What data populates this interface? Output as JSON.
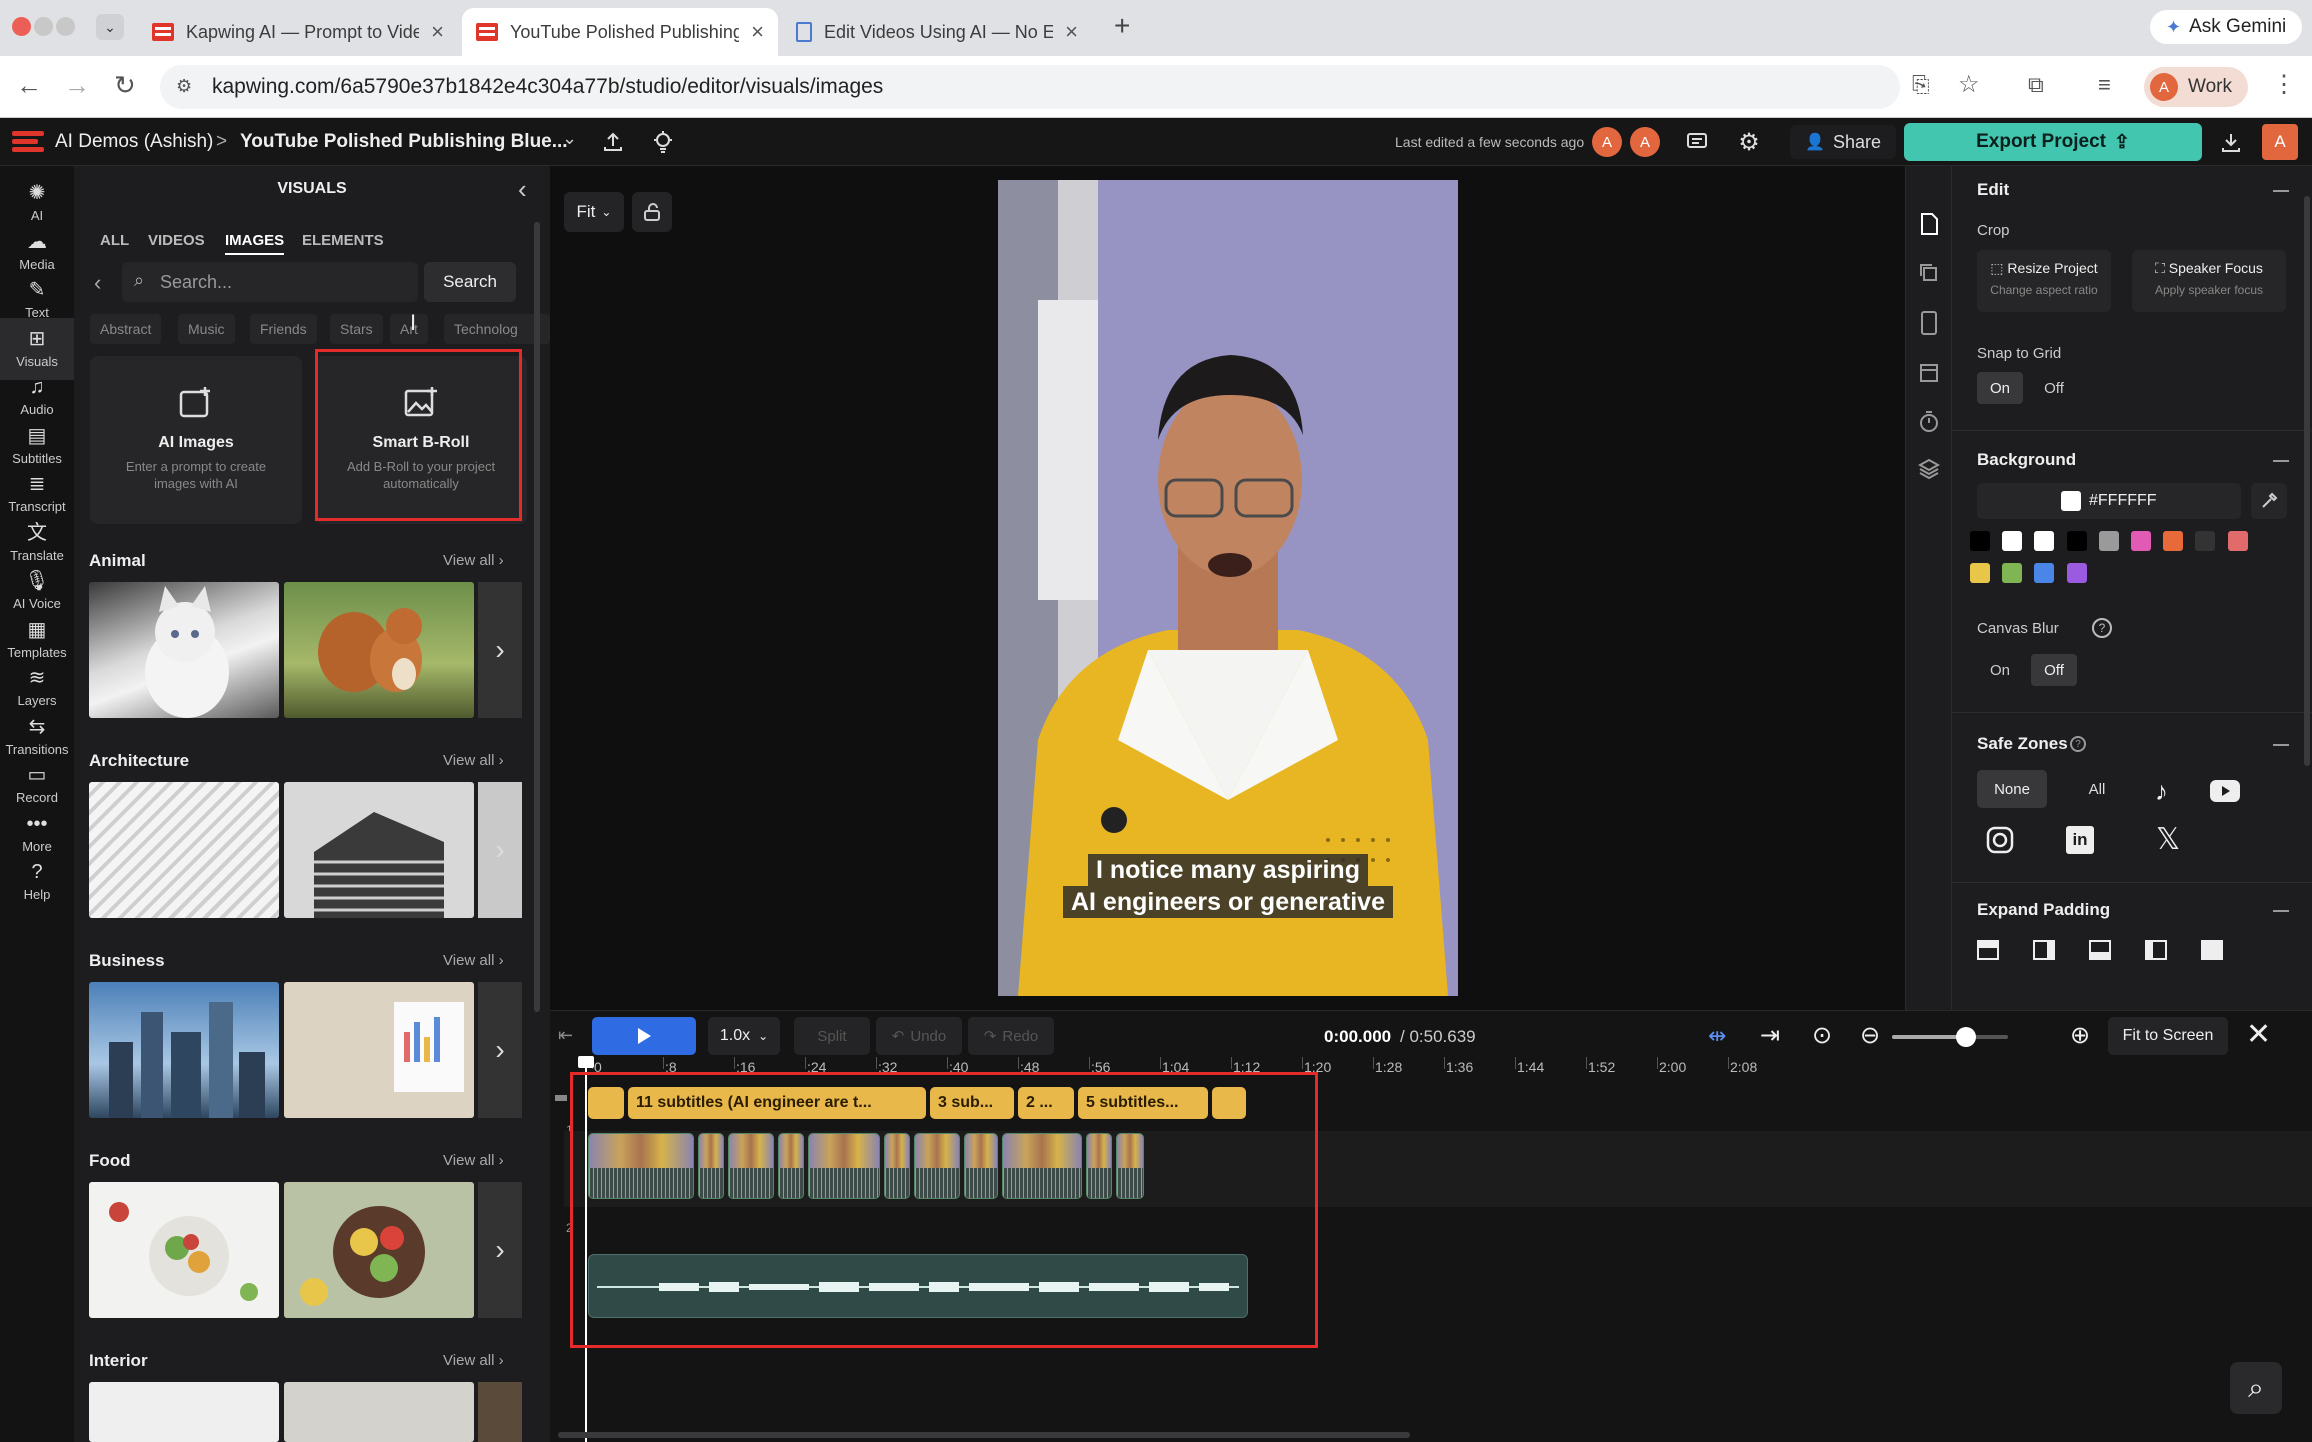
{
  "browser": {
    "tabs": [
      {
        "title": "Kapwing AI — Prompt to Vide",
        "close": "×"
      },
      {
        "title": "YouTube Polished Publishing",
        "close": "×"
      },
      {
        "title": "Edit Videos Using AI — No Ed",
        "close": "×"
      }
    ],
    "new_tab": "+",
    "ask_gemini": "Ask Gemini",
    "url": "kapwing.com/6a5790e37b1842e4c304a77b/studio/editor/visuals/images",
    "profile": "Work",
    "profile_initial": "A"
  },
  "header": {
    "workspace": "AI Demos (Ashish)",
    "separator": ">",
    "project": "YouTube Polished Publishing Blue...",
    "last_edited": "Last edited a few seconds ago",
    "avatars": [
      "A",
      "A"
    ],
    "share": "Share",
    "export": "Export Project",
    "user_initial": "A"
  },
  "rail": [
    {
      "label": "AI",
      "icon": "ai-sparkle-icon"
    },
    {
      "label": "Media",
      "icon": "media-upload-icon"
    },
    {
      "label": "Text",
      "icon": "text-edit-icon"
    },
    {
      "label": "Visuals",
      "icon": "visuals-grid-icon",
      "selected": true
    },
    {
      "label": "Audio",
      "icon": "music-note-icon"
    },
    {
      "label": "Subtitles",
      "icon": "subtitles-icon"
    },
    {
      "label": "Transcript",
      "icon": "transcript-icon"
    },
    {
      "label": "Translate",
      "icon": "translate-icon"
    },
    {
      "label": "AI Voice",
      "icon": "microphone-icon"
    },
    {
      "label": "Templates",
      "icon": "templates-icon"
    },
    {
      "label": "Layers",
      "icon": "layers-icon"
    },
    {
      "label": "Transitions",
      "icon": "transitions-icon"
    },
    {
      "label": "Record",
      "icon": "record-camera-icon"
    },
    {
      "label": "More",
      "icon": "more-dots-icon"
    },
    {
      "label": "Help",
      "icon": "help-circle-icon"
    }
  ],
  "visuals": {
    "title": "VISUALS",
    "tabs": [
      "ALL",
      "VIDEOS",
      "IMAGES",
      "ELEMENTS"
    ],
    "active_tab": "IMAGES",
    "search_placeholder": "Search...",
    "search_button": "Search",
    "chips": [
      "Abstract",
      "Music",
      "Friends",
      "Stars",
      "Art",
      "Technolog"
    ],
    "cards": [
      {
        "title": "AI Images",
        "subtitle": "Enter a prompt to create images with AI"
      },
      {
        "title": "Smart B-Roll",
        "subtitle": "Add B-Roll to your project automatically"
      }
    ],
    "view_all": "View all ›",
    "categories": [
      "Animal",
      "Architecture",
      "Business",
      "Food",
      "Interior"
    ]
  },
  "canvas": {
    "fit": "Fit",
    "caption_line1": "I notice many aspiring",
    "caption_line2": "AI engineers or generative"
  },
  "properties": {
    "edit": "Edit",
    "crop": "Crop",
    "resize_title": "Resize Project",
    "resize_sub": "Change aspect ratio",
    "speaker_title": "Speaker Focus",
    "speaker_sub": "Apply speaker focus",
    "snap": "Snap to Grid",
    "on": "On",
    "off": "Off",
    "background": "Background",
    "bg_hex": "#FFFFFF",
    "swatches": [
      "#000000",
      "#ffffff",
      "#ffffff",
      "#000000",
      "#9a9a9a",
      "#e15bb5",
      "#e8693a",
      "#333333",
      "#e16a6a",
      "#e8c64a",
      "#7fb552",
      "#4a86e8",
      "#9a5be0"
    ],
    "canvas_blur": "Canvas Blur",
    "safe_zones": "Safe Zones",
    "none": "None",
    "all": "All",
    "expand_padding": "Expand Padding"
  },
  "timeline": {
    "speed": "1.0x",
    "split": "Split",
    "undo": "Undo",
    "redo": "Redo",
    "time_current": "0:00.000",
    "time_total": "/ 0:50.639",
    "fit_screen": "Fit to Screen",
    "ticks": [
      "0",
      ":8",
      ":16",
      ":24",
      ":32",
      ":40",
      ":48",
      ":56",
      "1:04",
      "1:12",
      "1:20",
      "1:28",
      "1:36",
      "1:44",
      "1:52",
      "2:00",
      "2:08"
    ],
    "subtitle_clips": [
      "11 subtitles (AI engineer are t...",
      "3 sub...",
      "2 ...",
      "5 subtitles..."
    ],
    "track_numbers": [
      "1",
      "2"
    ]
  }
}
